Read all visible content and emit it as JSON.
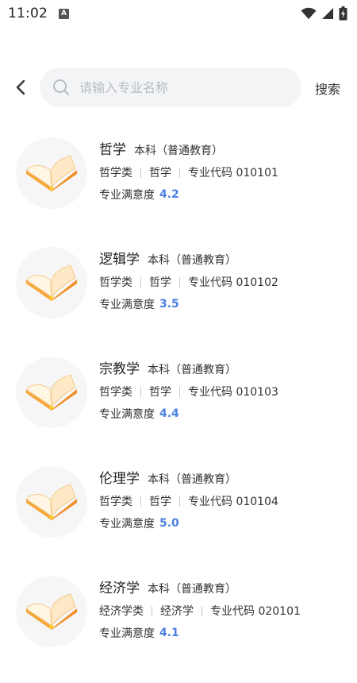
{
  "status": {
    "time": "11:02",
    "notif_badge": "A"
  },
  "search": {
    "placeholder": "请输入专业名称",
    "button_label": "搜索"
  },
  "majors": [
    {
      "name": "哲学",
      "level": "本科（普通教育）",
      "category": "哲学类",
      "discipline": "哲学",
      "code": "专业代码 010101",
      "satisfaction_label": "专业满意度",
      "score": "4.2"
    },
    {
      "name": "逻辑学",
      "level": "本科（普通教育）",
      "category": "哲学类",
      "discipline": "哲学",
      "code": "专业代码 010102",
      "satisfaction_label": "专业满意度",
      "score": "3.5"
    },
    {
      "name": "宗教学",
      "level": "本科（普通教育）",
      "category": "哲学类",
      "discipline": "哲学",
      "code": "专业代码 010103",
      "satisfaction_label": "专业满意度",
      "score": "4.4"
    },
    {
      "name": "伦理学",
      "level": "本科（普通教育）",
      "category": "哲学类",
      "discipline": "哲学",
      "code": "专业代码 010104",
      "satisfaction_label": "专业满意度",
      "score": "5.0"
    },
    {
      "name": "经济学",
      "level": "本科（普通教育）",
      "category": "经济学类",
      "discipline": "经济学",
      "code": "专业代码 020101",
      "satisfaction_label": "专业满意度",
      "score": "4.1"
    }
  ],
  "colors": {
    "accent": "#4a7fe0",
    "search_bg": "#f3f4f6"
  },
  "icons": {
    "book": "open-book-icon"
  }
}
